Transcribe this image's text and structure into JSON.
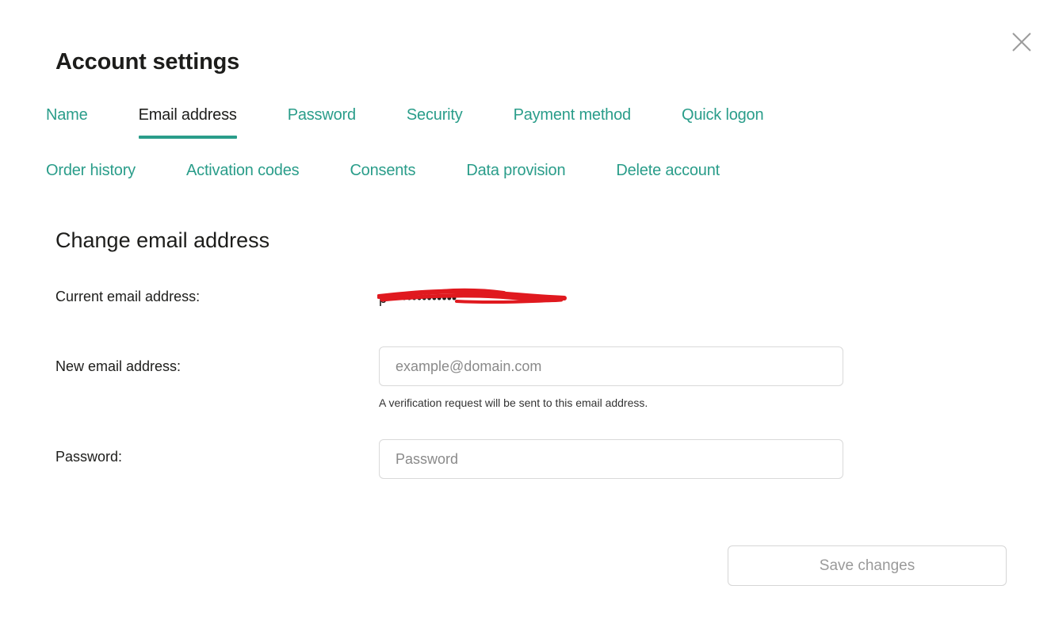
{
  "dialog": {
    "title": "Account settings",
    "close_icon": "close-icon"
  },
  "tabs": {
    "row1": [
      {
        "label": "Name",
        "active": false
      },
      {
        "label": "Email address",
        "active": true
      },
      {
        "label": "Password",
        "active": false
      },
      {
        "label": "Security",
        "active": false
      },
      {
        "label": "Payment method",
        "active": false
      },
      {
        "label": "Quick logon",
        "active": false
      }
    ],
    "row2": [
      {
        "label": "Order history",
        "active": false
      },
      {
        "label": "Activation codes",
        "active": false
      },
      {
        "label": "Consents",
        "active": false
      },
      {
        "label": "Data provision",
        "active": false
      },
      {
        "label": "Delete account",
        "active": false
      }
    ]
  },
  "form": {
    "section_title": "Change email address",
    "current_email_label": "Current email address:",
    "current_email_value": "p••••••••••••••",
    "new_email_label": "New email address:",
    "new_email_placeholder": "example@domain.com",
    "new_email_hint": "A verification request will be sent to this email address.",
    "password_label": "Password:",
    "password_placeholder": "Password",
    "save_label": "Save changes"
  },
  "colors": {
    "accent": "#2a9d8a",
    "text": "#1d1d1b",
    "redaction": "#e0191f",
    "disabled_text": "#9a9a9a"
  }
}
